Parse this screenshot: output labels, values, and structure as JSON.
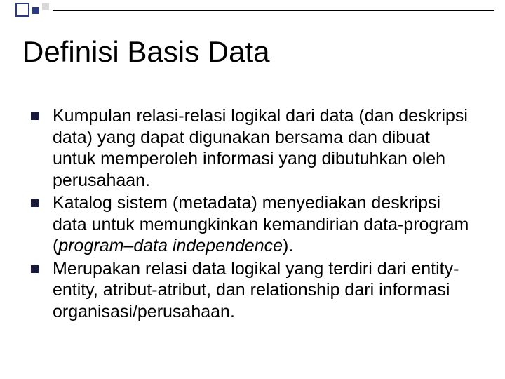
{
  "title": "Definisi  Basis Data",
  "bullets": {
    "0": "Kumpulan relasi-relasi logikal dari data (dan deskripsi data) yang dapat digunakan bersama dan dibuat untuk memperoleh informasi yang dibutuhkan oleh perusahaan.",
    "1": {
      "a": "Katalog sistem (metadata) menyediakan deskripsi data untuk memungkinkan kemandirian data-program (",
      "em": "program–data independence",
      "b": ")."
    },
    "2": "Merupakan relasi data logikal yang terdiri dari entity-entity, atribut-atribut, dan relationship dari informasi organisasi/perusahaan."
  }
}
